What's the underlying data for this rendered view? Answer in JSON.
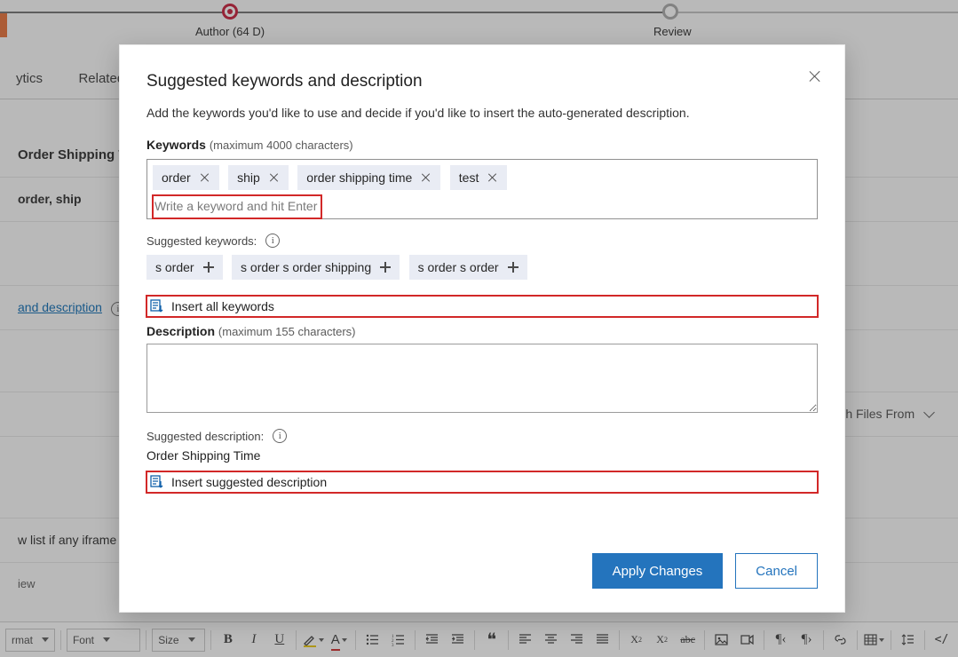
{
  "stepper": {
    "author_label": "Author  (64 D)",
    "review_label": "Review"
  },
  "background": {
    "tabs": {
      "analytics": "ytics",
      "related": "Related"
    },
    "title_row": "Order Shipping Time",
    "keywords_row": "order, ship",
    "suggest_link": " and description",
    "attach_label": "ach Files From",
    "iframe_text": "w list if any iframe in t",
    "view_text": "iew"
  },
  "toolbar": {
    "format": "rmat",
    "font": "Font",
    "size": "Size"
  },
  "modal": {
    "title": "Suggested keywords and description",
    "subtitle": "Add the keywords you'd like to use and decide if you'd like to insert the auto-generated description.",
    "keywords_label": "Keywords",
    "keywords_hint": "(maximum 4000 characters)",
    "keywords": [
      "order",
      "ship",
      "order shipping time",
      "test"
    ],
    "keyword_placeholder": "Write a keyword and hit Enter",
    "suggested_label": "Suggested keywords:",
    "suggested_keywords": [
      "s order",
      "s order s order shipping",
      "s order s order"
    ],
    "insert_keywords": "Insert all keywords",
    "description_label": "Description",
    "description_hint": "(maximum 155 characters)",
    "description_value": "",
    "suggested_desc_label": "Suggested description:",
    "suggested_desc_text": "Order Shipping Time",
    "insert_description": "Insert suggested description",
    "apply": "Apply Changes",
    "cancel": "Cancel"
  }
}
